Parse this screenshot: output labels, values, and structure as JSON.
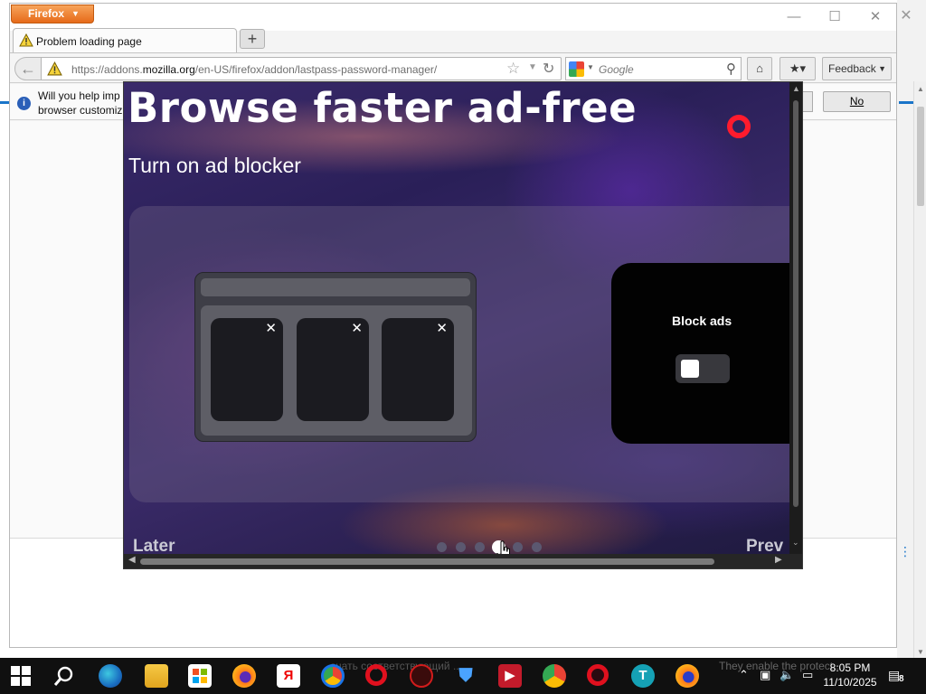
{
  "firefox": {
    "menu_label": "Firefox",
    "tab_title": "Problem loading page",
    "new_tab_symbol": "+",
    "url_host_prefix": "https://addons.",
    "url_host": "mozilla.org",
    "url_path": "/en-US/firefox/addon/lastpass-password-manager/",
    "search_placeholder": "Google",
    "feedback_label": "Feedback",
    "notification_line1": "Will you help imp",
    "notification_line2": "browser customiz",
    "no_label": "No"
  },
  "opera": {
    "headline": "Browse faster ad-free",
    "subtitle": "Turn on ad blocker",
    "block_ads_label": "Block ads",
    "close_symbol": "✕",
    "later_label": "Later",
    "prev_label": "Prev",
    "page_count": 6,
    "active_page": 4,
    "toggle_on": false,
    "brand_color": "#ff1b2d"
  },
  "taskbar": {
    "time": "8:05 PM",
    "date": "11/10/2025",
    "notification_count": "8",
    "behind_text": "ачать соответствующий ...",
    "behind_text2": "They enable the protect..."
  },
  "icons": [
    "windows-start-icon",
    "search-icon",
    "edge-icon",
    "file-explorer-icon",
    "store-icon",
    "firefox-icon",
    "yandex-icon",
    "chrome-icon",
    "opera-icon",
    "antivirus-icon",
    "shield-icon",
    "video-icon",
    "chrome-beta-icon",
    "opera-gx-icon",
    "teams-icon",
    "firefox-2-icon"
  ]
}
